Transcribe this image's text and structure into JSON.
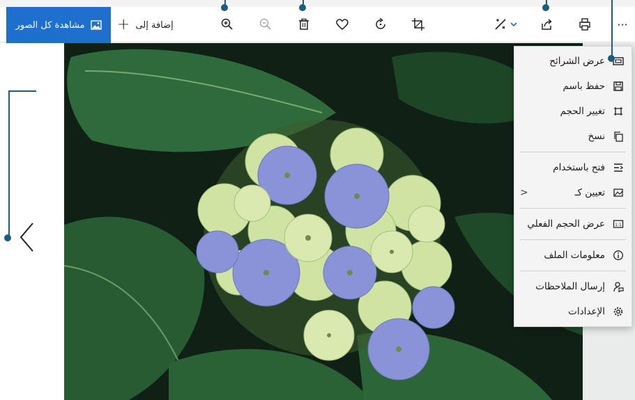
{
  "toolbar": {
    "view_all_label": "مشاهدة كل الصور",
    "add_to_label": "إضافة إلى",
    "icons": [
      "zoom-in-icon",
      "zoom-out-icon",
      "delete-icon",
      "favorite-icon",
      "rotate-icon",
      "crop-icon",
      "edit-icon",
      "share-icon",
      "print-icon",
      "more-icon"
    ],
    "more_label": "···"
  },
  "menu": {
    "items": [
      {
        "label": "عرض الشرائح",
        "icon": "slideshow-icon"
      },
      {
        "label": "حفظ باسم",
        "icon": "save-as-icon"
      },
      {
        "label": "تغيير الحجم",
        "icon": "resize-icon"
      },
      {
        "label": "نسخ",
        "icon": "copy-icon"
      },
      {
        "label": "فتح باستخدام",
        "icon": "open-with-icon"
      },
      {
        "label": "تعيين كـ",
        "icon": "set-as-icon"
      },
      {
        "label": "عرض الحجم الفعلي",
        "icon": "actual-size-icon"
      },
      {
        "label": "معلومات الملف",
        "icon": "info-icon"
      },
      {
        "label": "إرسال الملاحظات",
        "icon": "feedback-icon"
      },
      {
        "label": "الإعدادات",
        "icon": "settings-icon"
      }
    ],
    "submenu_arrow": "<"
  },
  "colors": {
    "accent": "#1f6fcf",
    "callout": "#1b5d7a"
  }
}
